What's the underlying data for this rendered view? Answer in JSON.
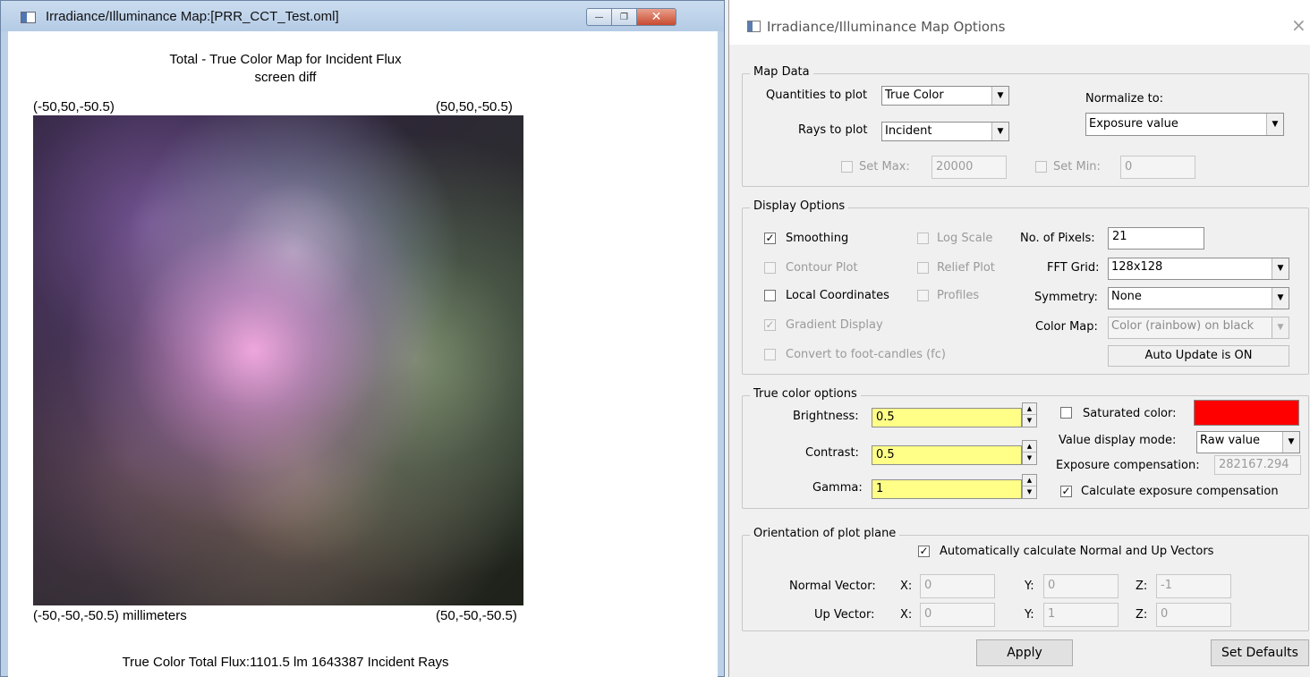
{
  "map_window": {
    "title": "Irradiance/Illuminance Map:[PRR_CCT_Test.oml]",
    "plot_title": "Total - True Color Map for Incident Flux",
    "plot_subtitle": "screen diff",
    "corner_top_left": "(-50,50,-50.5)",
    "corner_top_right": "(50,50,-50.5)",
    "corner_bottom_left": "(-50,-50,-50.5) millimeters",
    "corner_bottom_right": "(50,-50,-50.5)",
    "flux_summary": "True Color Total Flux:1101.5 lm 1643387 Incident Rays"
  },
  "options_dialog": {
    "title": "Irradiance/Illuminance Map Options",
    "close_glyph": "×",
    "map_data": {
      "legend": "Map Data",
      "quantities_label": "Quantities to plot",
      "quantities_value": "True Color",
      "rays_label": "Rays to plot",
      "rays_value": "Incident",
      "normalize_label": "Normalize to:",
      "normalize_value": "Exposure value",
      "set_max_label": "Set Max:",
      "set_max_value": "20000",
      "set_min_label": "Set Min:",
      "set_min_value": "0"
    },
    "display_options": {
      "legend": "Display Options",
      "smoothing": "Smoothing",
      "log_scale": "Log Scale",
      "contour_plot": "Contour Plot",
      "relief_plot": "Relief Plot",
      "local_coordinates": "Local Coordinates",
      "profiles": "Profiles",
      "gradient_display": "Gradient Display",
      "convert_fc": "Convert to foot-candles (fc)",
      "pixels_label": "No. of Pixels:",
      "pixels_value": "21",
      "fft_label": "FFT Grid:",
      "fft_value": "128x128",
      "symmetry_label": "Symmetry:",
      "symmetry_value": "None",
      "colormap_label": "Color Map:",
      "colormap_value": "Color (rainbow) on black",
      "auto_update": "Auto Update is ON"
    },
    "true_color": {
      "legend": "True color options",
      "brightness_label": "Brightness:",
      "brightness_value": "0.5",
      "contrast_label": "Contrast:",
      "contrast_value": "0.5",
      "gamma_label": "Gamma:",
      "gamma_value": "1",
      "saturated_label": "Saturated color:",
      "saturated_color": "#ff0000",
      "value_mode_label": "Value display mode:",
      "value_mode_value": "Raw value",
      "exposure_label": "Exposure compensation:",
      "exposure_value": "282167.294",
      "calc_exposure": "Calculate exposure compensation"
    },
    "orientation": {
      "legend": "Orientation of plot plane",
      "auto_calc": "Automatically calculate Normal and Up Vectors",
      "normal_label": "Normal Vector:",
      "up_label": "Up Vector:",
      "x_label": "X:",
      "y_label": "Y:",
      "z_label": "Z:",
      "normal_x": "0",
      "normal_y": "0",
      "normal_z": "-1",
      "up_x": "0",
      "up_y": "1",
      "up_z": "0"
    },
    "apply_label": "Apply",
    "defaults_label": "Set Defaults"
  },
  "icons": {
    "check_glyph": "✓",
    "dropdown_glyph": "▼",
    "spin_up_glyph": "▲",
    "spin_down_glyph": "▼",
    "minimize_glyph": "—",
    "maximize_glyph": "❐",
    "close_glyph": "✕"
  }
}
